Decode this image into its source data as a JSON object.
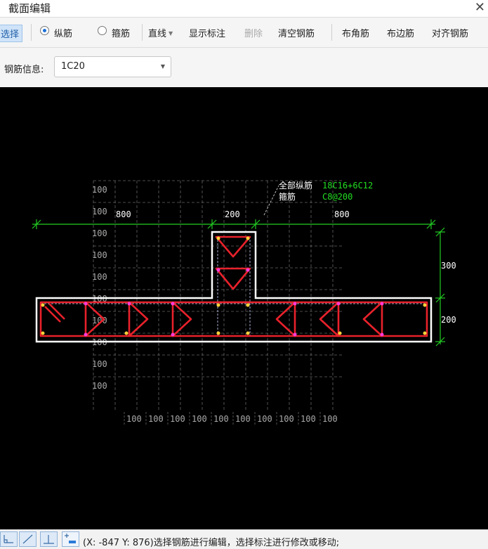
{
  "window": {
    "title": "截面编辑",
    "close_glyph": "✕"
  },
  "toolbar": {
    "select_label": "选择",
    "radio_longitudinal": "纵筋",
    "radio_stirrup": "箍筋",
    "line_mode": "直线",
    "show_annotation": "显示标注",
    "delete": "删除",
    "clear_rebar": "清空钢筋",
    "corner_rebar": "布角筋",
    "edge_rebar": "布边筋",
    "align_rebar": "对齐钢筋"
  },
  "rebar_info": {
    "label": "钢筋信息:",
    "value": "1C20"
  },
  "canvas": {
    "grid_label": "100",
    "dim_top": [
      "800",
      "200",
      "800"
    ],
    "dim_right": [
      "300",
      "200"
    ],
    "leader_all_long": "全部纵筋",
    "leader_stirrup": "箍筋",
    "long_spec": "18C16+6C12",
    "stirrup_spec": "C8@200",
    "colors": {
      "background": "#000000",
      "outline": "#ffffff",
      "rebar": "#e8212b",
      "dimension": "#22cc22",
      "grid": "#666666",
      "label_green": "#22dd22",
      "node": "#ffd23a",
      "node_magenta": "#ff3ad8"
    }
  },
  "status": {
    "coords": "(X: -847 Y: 876)",
    "hint": "选择钢筋进行编辑，选择标注进行修改或移动;"
  }
}
